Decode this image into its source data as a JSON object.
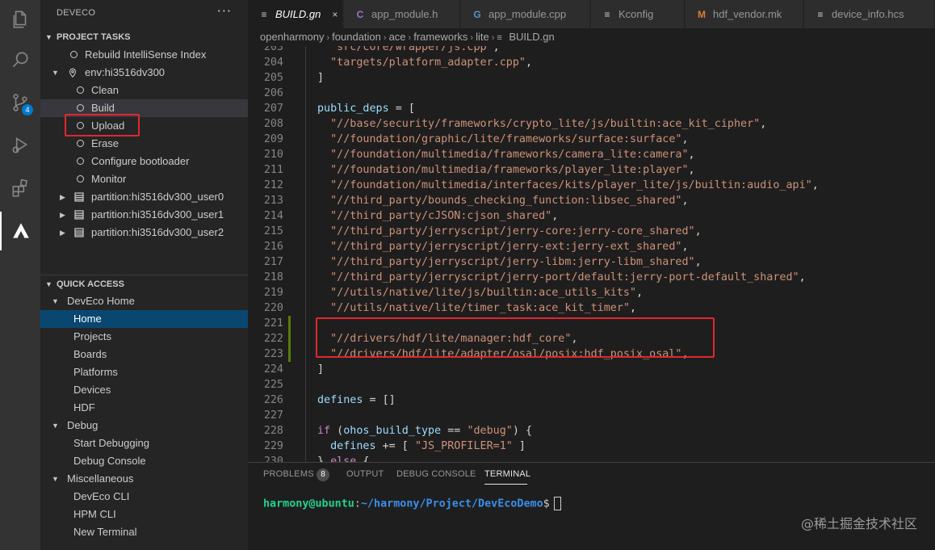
{
  "activity_bar": {
    "items": [
      {
        "icon": "files-icon"
      },
      {
        "icon": "search-icon"
      },
      {
        "icon": "source-control-icon",
        "badge": "4"
      },
      {
        "icon": "run-debug-icon"
      },
      {
        "icon": "extensions-icon"
      },
      {
        "icon": "deveco-icon",
        "active": true
      }
    ]
  },
  "sidebar": {
    "title": "DEVECO",
    "more": "···",
    "project_tasks": {
      "header": "PROJECT TASKS",
      "rebuild": "Rebuild IntelliSense Index",
      "env": "env:hi3516dv300",
      "tasks": [
        "Clean",
        "Build",
        "Upload",
        "Erase",
        "Configure bootloader",
        "Monitor"
      ],
      "partitions": [
        "partition:hi3516dv300_user0",
        "partition:hi3516dv300_user1",
        "partition:hi3516dv300_user2"
      ]
    },
    "quick_access": {
      "header": "QUICK ACCESS",
      "groups": [
        {
          "label": "DevEco Home",
          "items": [
            "Home",
            "Projects",
            "Boards",
            "Platforms",
            "Devices",
            "HDF"
          ]
        },
        {
          "label": "Debug",
          "items": [
            "Start Debugging",
            "Debug Console"
          ]
        },
        {
          "label": "Miscellaneous",
          "items": [
            "DevEco CLI",
            "HPM CLI",
            "New Terminal"
          ]
        }
      ]
    }
  },
  "tabs": [
    {
      "label": "BUILD.gn",
      "icon": "≡",
      "active": true,
      "close": "×"
    },
    {
      "label": "app_module.h",
      "icon": "C"
    },
    {
      "label": "app_module.cpp",
      "icon": "G"
    },
    {
      "label": "Kconfig",
      "icon": "≡"
    },
    {
      "label": "hdf_vendor.mk",
      "icon": "M"
    },
    {
      "label": "device_info.hcs",
      "icon": "≡"
    }
  ],
  "breadcrumb": [
    "openharmony",
    "foundation",
    "ace",
    "frameworks",
    "lite",
    "BUILD.gn"
  ],
  "editor": {
    "lines": [
      {
        "n": "203",
        "t": "  \"src/core/wrapper/js.cpp\","
      },
      {
        "n": "204",
        "t": "  \"targets/platform_adapter.cpp\","
      },
      {
        "n": "205",
        "t": "]"
      },
      {
        "n": "206",
        "t": ""
      },
      {
        "n": "207",
        "t": "public_deps = ["
      },
      {
        "n": "208",
        "t": "  \"//base/security/frameworks/crypto_lite/js/builtin:ace_kit_cipher\","
      },
      {
        "n": "209",
        "t": "  \"//foundation/graphic/lite/frameworks/surface:surface\","
      },
      {
        "n": "210",
        "t": "  \"//foundation/multimedia/frameworks/camera_lite:camera\","
      },
      {
        "n": "211",
        "t": "  \"//foundation/multimedia/frameworks/player_lite:player\","
      },
      {
        "n": "212",
        "t": "  \"//foundation/multimedia/interfaces/kits/player_lite/js/builtin:audio_api\","
      },
      {
        "n": "213",
        "t": "  \"//third_party/bounds_checking_function:libsec_shared\","
      },
      {
        "n": "214",
        "t": "  \"//third_party/cJSON:cjson_shared\","
      },
      {
        "n": "215",
        "t": "  \"//third_party/jerryscript/jerry-core:jerry-core_shared\","
      },
      {
        "n": "216",
        "t": "  \"//third_party/jerryscript/jerry-ext:jerry-ext_shared\","
      },
      {
        "n": "217",
        "t": "  \"//third_party/jerryscript/jerry-libm:jerry-libm_shared\","
      },
      {
        "n": "218",
        "t": "  \"//third_party/jerryscript/jerry-port/default:jerry-port-default_shared\","
      },
      {
        "n": "219",
        "t": "  \"//utils/native/lite/js/builtin:ace_utils_kits\","
      },
      {
        "n": "220",
        "t": "  \"//utils/native/lite/timer_task:ace_kit_timer\","
      },
      {
        "n": "221",
        "t": "",
        "mod": true
      },
      {
        "n": "222",
        "t": "  \"//drivers/hdf/lite/manager:hdf_core\",",
        "mod": true
      },
      {
        "n": "223",
        "t": "  \"//drivers/hdf/lite/adapter/osal/posix:hdf_posix_osal\",",
        "mod": true
      },
      {
        "n": "224",
        "t": "]"
      },
      {
        "n": "225",
        "t": ""
      },
      {
        "n": "226",
        "t": "defines = []"
      },
      {
        "n": "227",
        "t": ""
      },
      {
        "n": "228",
        "t": "if (ohos_build_type == \"debug\") {"
      },
      {
        "n": "229",
        "t": "  defines += [ \"JS_PROFILER=1\" ]"
      },
      {
        "n": "230",
        "t": "} else {"
      }
    ]
  },
  "panel": {
    "tabs": [
      "PROBLEMS",
      "OUTPUT",
      "DEBUG CONSOLE",
      "TERMINAL"
    ],
    "problems_count": "8",
    "active_tab": "TERMINAL",
    "terminal": {
      "user": "harmony@ubuntu",
      "colon": ":",
      "path": "~/harmony/Project/DevEcoDemo",
      "prompt": "$"
    }
  },
  "watermark": "@稀土掘金技术社区",
  "colors": {
    "accent": "#007acc",
    "highlight_box": "#e0282d",
    "selection": "#094771",
    "string": "#ce9178"
  }
}
